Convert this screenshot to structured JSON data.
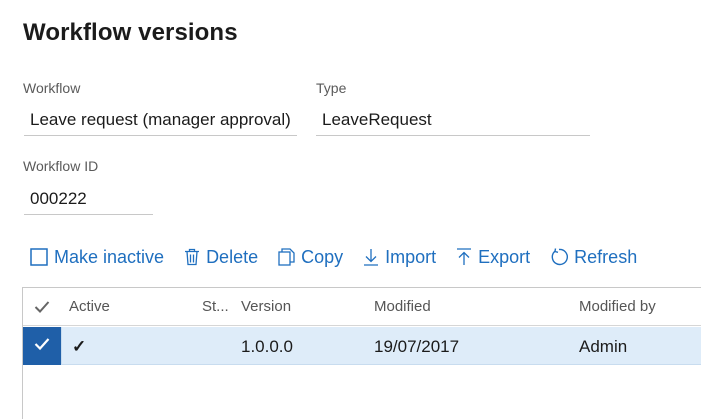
{
  "page": {
    "title": "Workflow versions"
  },
  "fields": {
    "workflow": {
      "label": "Workflow",
      "value": "Leave request (manager approval)"
    },
    "type": {
      "label": "Type",
      "value": "LeaveRequest"
    },
    "workflow_id": {
      "label": "Workflow ID",
      "value": "000222"
    }
  },
  "toolbar": {
    "make_inactive": "Make inactive",
    "delete": "Delete",
    "copy": "Copy",
    "import": "Import",
    "export": "Export",
    "refresh": "Refresh"
  },
  "grid": {
    "columns": {
      "active": "Active",
      "status": "St...",
      "version": "Version",
      "modified": "Modified",
      "modified_by": "Modified by"
    },
    "rows": [
      {
        "active": "✓",
        "status": "",
        "version": "1.0.0.0",
        "modified": "19/07/2017",
        "modified_by": "Admin",
        "selected": true
      }
    ]
  },
  "colors": {
    "accent": "#1f6fbf",
    "selected_row": "#deecf9",
    "row_check": "#1f5fa8"
  }
}
